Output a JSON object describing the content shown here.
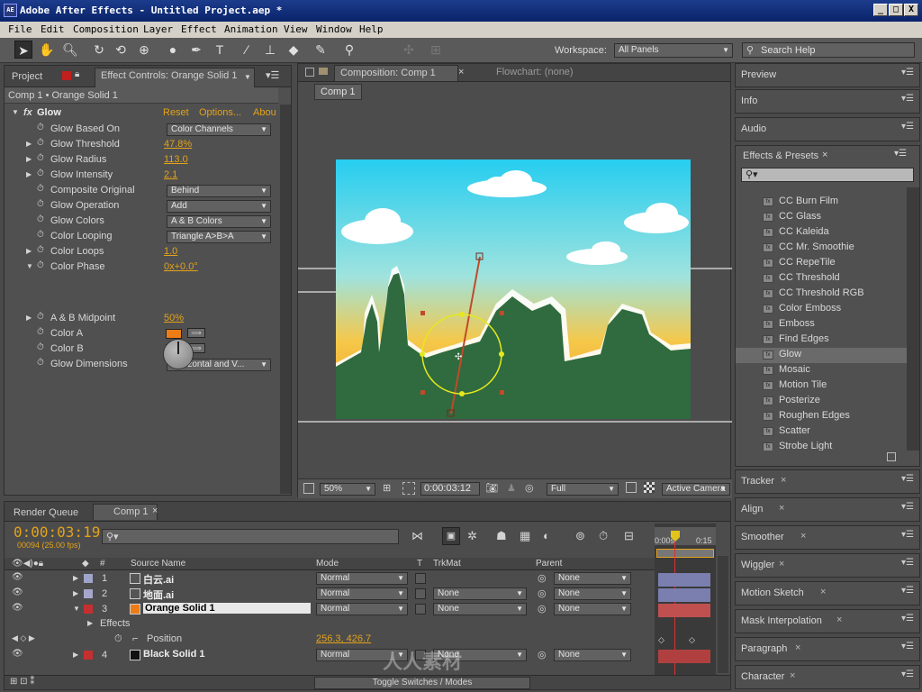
{
  "app": {
    "title": "Adobe After Effects - Untitled Project.aep *",
    "icon_text": "AE",
    "window_buttons": [
      "_",
      "□",
      "X"
    ]
  },
  "menu": [
    "File",
    "Edit",
    "Composition",
    "Layer",
    "Effect",
    "Animation",
    "View",
    "Window",
    "Help"
  ],
  "toolbar": {
    "tools": [
      "selection-tool",
      "hand-tool",
      "zoom-tool",
      "rotation-tool",
      "camera-orbit-tool",
      "pan-behind-tool",
      "mask-tool",
      "type-tool",
      "brush-tool",
      "clone-stamp-tool",
      "eraser-tool",
      "roto-brush-tool",
      "puppet-pin-tool"
    ],
    "workspace_label": "Workspace:",
    "workspace_value": "All Panels",
    "search_placeholder": "Search Help"
  },
  "project_panel": {
    "tab_project": "Project",
    "tab_effect_controls": "Effect Controls: Orange Solid 1",
    "layer_path": "Comp 1 • Orange Solid 1",
    "effect_name": "Glow",
    "fx_label": "fx",
    "reset": "Reset",
    "options": "Options...",
    "about": "Abou",
    "properties": [
      {
        "label": "Glow Based On",
        "kind": "dropdown",
        "value": "Color Channels"
      },
      {
        "label": "Glow Threshold",
        "kind": "value",
        "value": "47.8%"
      },
      {
        "label": "Glow Radius",
        "kind": "value",
        "value": "113.0"
      },
      {
        "label": "Glow Intensity",
        "kind": "value",
        "value": "2.1"
      },
      {
        "label": "Composite Original",
        "kind": "dropdown",
        "value": "Behind"
      },
      {
        "label": "Glow Operation",
        "kind": "dropdown",
        "value": "Add"
      },
      {
        "label": "Glow Colors",
        "kind": "dropdown",
        "value": "A & B Colors"
      },
      {
        "label": "Color Looping",
        "kind": "dropdown",
        "value": "Triangle A>B>A"
      },
      {
        "label": "Color Loops",
        "kind": "value",
        "value": "1.0"
      },
      {
        "label": "Color Phase",
        "kind": "value",
        "value": "0x+0.0°"
      },
      {
        "label": "A & B Midpoint",
        "kind": "value",
        "value": "50%"
      },
      {
        "label": "Color A",
        "kind": "color",
        "value": "#ec7d16"
      },
      {
        "label": "Color B",
        "kind": "color",
        "value": "#f5c516"
      },
      {
        "label": "Glow Dimensions",
        "kind": "dropdown",
        "value": "Horizontal and V..."
      }
    ]
  },
  "comp_panel": {
    "tab_comp": "Composition: Comp 1",
    "tab_flowchart": "Flowchart: (none)",
    "comp_button": "Comp 1",
    "zoom": "50%",
    "timecode": "0:00:03:12",
    "resolution": "Full",
    "camera": "Active Camera"
  },
  "right_panels": {
    "preview": "Preview",
    "info": "Info",
    "audio": "Audio",
    "effects_presets": "Effects & Presets",
    "search_placeholder": "",
    "effects_list": [
      "CC Burn Film",
      "CC Glass",
      "CC Kaleida",
      "CC Mr. Smoothie",
      "CC RepeTile",
      "CC Threshold",
      "CC Threshold RGB",
      "Color Emboss",
      "Emboss",
      "Find Edges",
      "Glow",
      "Mosaic",
      "Motion Tile",
      "Posterize",
      "Roughen Edges",
      "Scatter",
      "Strobe Light"
    ],
    "selected_effect": "Glow",
    "lower_panels": [
      "Tracker",
      "Align",
      "Smoother",
      "Wiggler",
      "Motion Sketch",
      "Mask Interpolation",
      "Paragraph",
      "Character"
    ]
  },
  "timeline": {
    "tab_render_queue": "Render Queue",
    "tab_comp": "Comp 1",
    "timecode": "0:00:03:19",
    "frame_info": "00094 (25.00 fps)",
    "search_placeholder": "",
    "columns": {
      "num": "#",
      "source": "Source Name",
      "mode": "Mode",
      "t": "T",
      "trkmat": "TrkMat",
      "parent": "Parent"
    },
    "ruler": [
      "0:00s",
      "0:15"
    ],
    "layers": [
      {
        "num": "1",
        "name": "白云.ai",
        "color": "#9fa5c9",
        "mode": "Normal",
        "trkmat": "",
        "parent": "None",
        "bar": "#7a7fb0"
      },
      {
        "num": "2",
        "name": "地面.ai",
        "color": "#a6a6cc",
        "mode": "Normal",
        "trkmat": "None",
        "parent": "None",
        "bar": "#7a7fb0"
      },
      {
        "num": "3",
        "name": "Orange Solid 1",
        "color": "#c43030",
        "mode": "Normal",
        "trkmat": "None",
        "parent": "None",
        "bar": "#c05050",
        "selected": true
      },
      {
        "num": "4",
        "name": "Black Solid 1",
        "color": "#c43030",
        "mode": "Normal",
        "trkmat": "None",
        "parent": "None",
        "bar": "#b04040"
      }
    ],
    "effects_label": "Effects",
    "position_label": "Position",
    "position_value": "256.3, 426.7",
    "toggle_label": "Toggle Switches / Modes"
  },
  "colors": {
    "accent_orange": "#e3a21a",
    "panel_bg": "#505050",
    "selection_blue": "#2a4f8a"
  },
  "watermark": "人人素材"
}
